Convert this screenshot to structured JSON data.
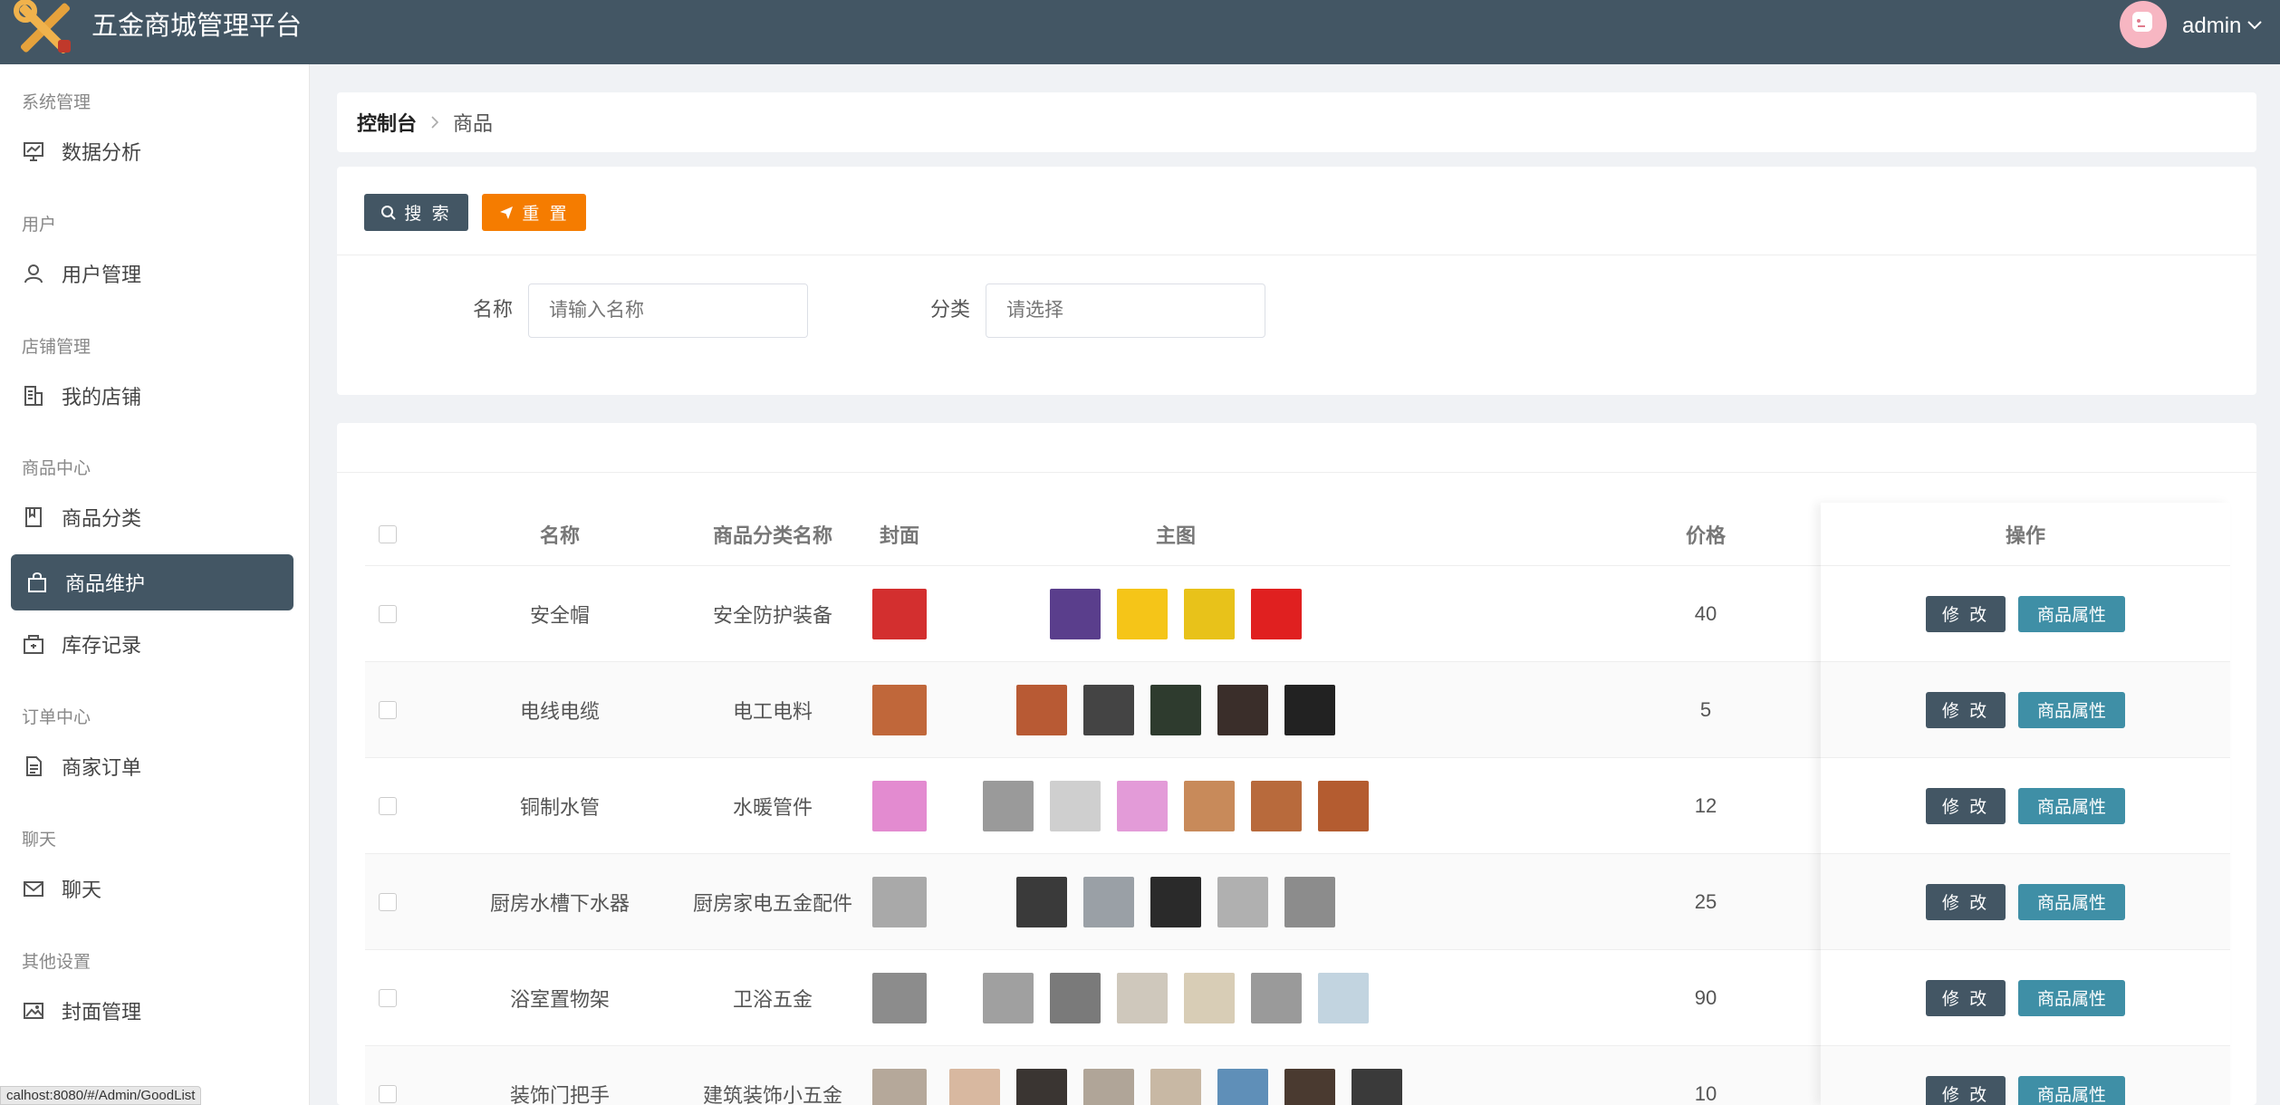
{
  "header": {
    "title": "五金商城管理平台",
    "user": "admin"
  },
  "sidebar": {
    "groups": [
      {
        "label": "系统管理",
        "items": [
          {
            "label": "数据分析",
            "icon": "chart-icon"
          }
        ]
      },
      {
        "label": "用户",
        "items": [
          {
            "label": "用户管理",
            "icon": "user-icon"
          }
        ]
      },
      {
        "label": "店铺管理",
        "items": [
          {
            "label": "我的店铺",
            "icon": "building-icon"
          }
        ]
      },
      {
        "label": "商品中心",
        "items": [
          {
            "label": "商品分类",
            "icon": "book-icon"
          },
          {
            "label": "商品维护",
            "icon": "bag-icon",
            "active": true
          },
          {
            "label": "库存记录",
            "icon": "box-icon"
          }
        ]
      },
      {
        "label": "订单中心",
        "items": [
          {
            "label": "商家订单",
            "icon": "document-icon"
          }
        ]
      },
      {
        "label": "聊天",
        "items": [
          {
            "label": "聊天",
            "icon": "mail-icon"
          }
        ]
      },
      {
        "label": "其他设置",
        "items": [
          {
            "label": "封面管理",
            "icon": "image-icon"
          }
        ]
      }
    ]
  },
  "breadcrumb": {
    "home": "控制台",
    "current": "商品"
  },
  "search": {
    "search_label": "搜 索",
    "reset_label": "重 置",
    "name_label": "名称",
    "name_placeholder": "请输入名称",
    "category_label": "分类",
    "category_placeholder": "请选择"
  },
  "table": {
    "columns": {
      "name": "名称",
      "category": "商品分类名称",
      "cover": "封面",
      "images": "主图",
      "price": "价格",
      "actions": "操作"
    },
    "edit_label": "修 改",
    "attr_label": "商品属性",
    "rows": [
      {
        "name": "安全帽",
        "category": "安全防护装备",
        "price": "40",
        "cover_color": "#d32f2f",
        "image_colors": [
          "#5a3e8c",
          "#f5c518",
          "#e8c21a",
          "#e02020"
        ]
      },
      {
        "name": "电线电缆",
        "category": "电工电料",
        "price": "5",
        "cover_color": "#c0673a",
        "image_colors": [
          "#b85a34",
          "#444444",
          "#2e3b2e",
          "#3a2e2a",
          "#222222"
        ]
      },
      {
        "name": "铜制水管",
        "category": "水暖管件",
        "price": "12",
        "cover_color": "#e38bd0",
        "image_colors": [
          "#9a9a9a",
          "#cfcfcf",
          "#e39bd8",
          "#c88a5a",
          "#b86a3c",
          "#b45c30"
        ]
      },
      {
        "name": "厨房水槽下水器",
        "category": "厨房家电五金配件",
        "price": "25",
        "cover_color": "#a9a9a9",
        "image_colors": [
          "#3a3a3a",
          "#9aa0a6",
          "#2a2a2a",
          "#b0b0b0",
          "#8c8c8c"
        ]
      },
      {
        "name": "浴室置物架",
        "category": "卫浴五金",
        "price": "90",
        "cover_color": "#8c8c8c",
        "image_colors": [
          "#a0a0a0",
          "#7a7a7a",
          "#cfc8bc",
          "#d8cdb6",
          "#9a9a9a",
          "#c2d4e0"
        ]
      },
      {
        "name": "装饰门把手",
        "category": "建筑装饰小五金",
        "price": "10",
        "cover_color": "#b5a89a",
        "image_colors": [
          "#d8b8a0",
          "#3a3532",
          "#b0a598",
          "#c8b8a4",
          "#5f8fb8",
          "#4a3a30",
          "#3a3a3a"
        ]
      }
    ]
  },
  "status_url": "calhost:8080/#/Admin/GoodList"
}
